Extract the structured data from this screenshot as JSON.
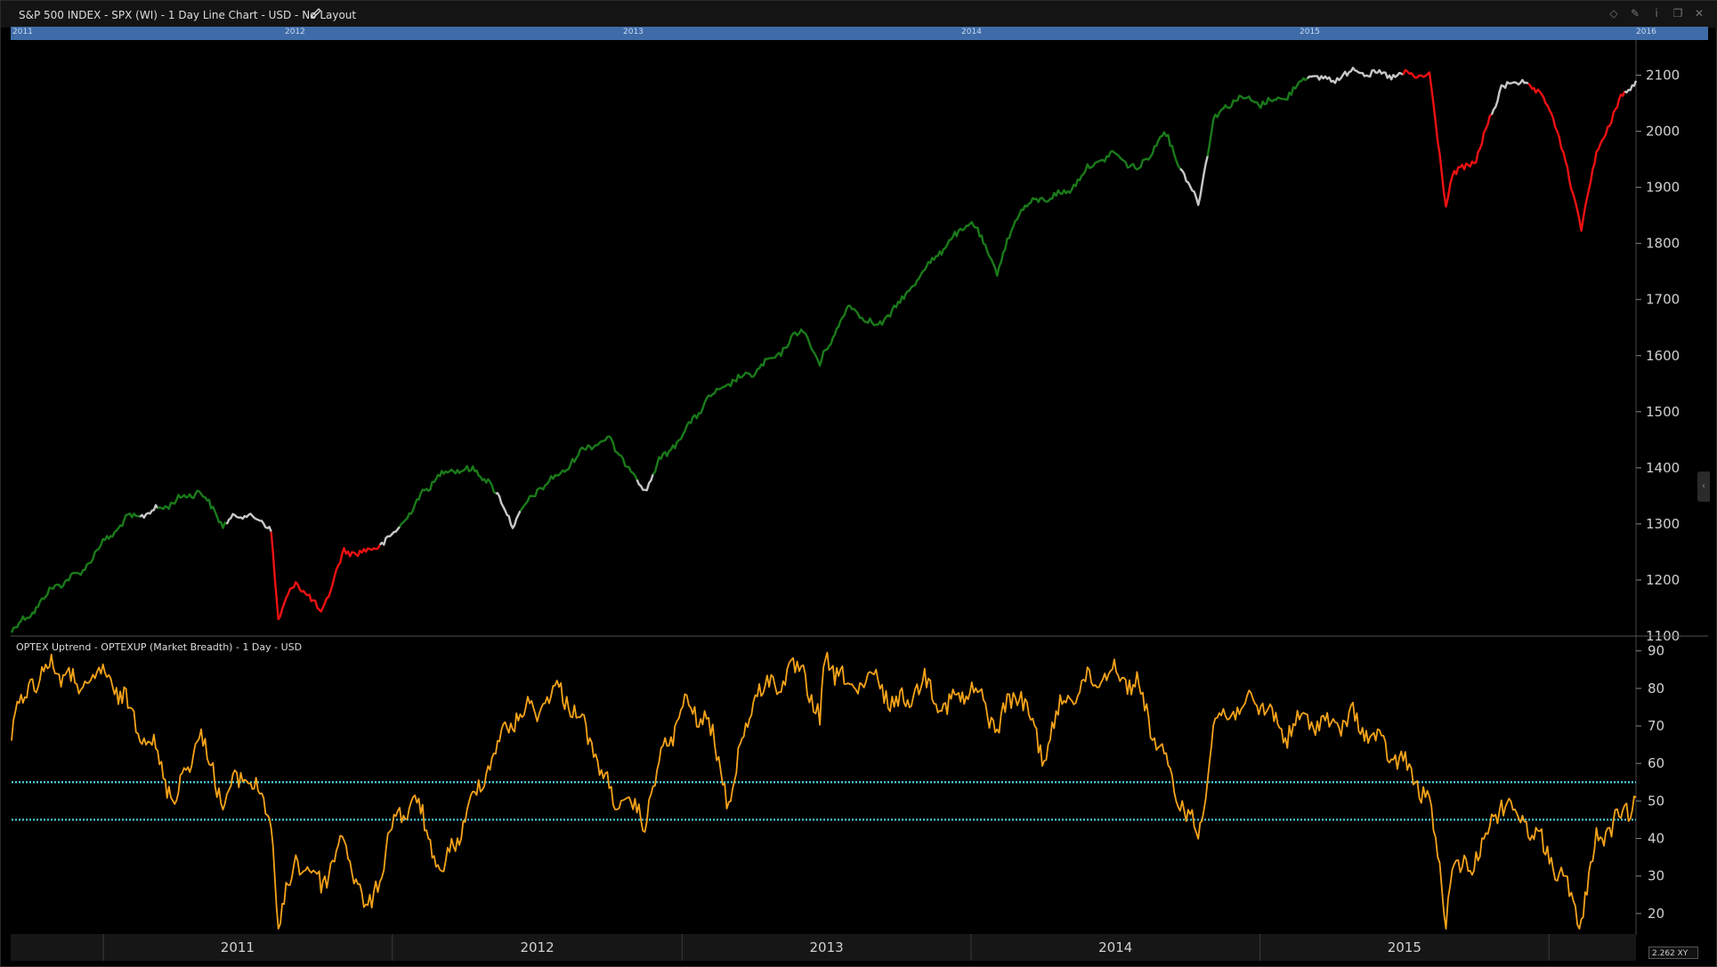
{
  "header": {
    "title": "S&P 500 INDEX - SPX (WI) - 1 Day Line Chart - USD - No Layout",
    "icons": [
      "pencil-icon",
      "diamond-icon",
      "pin-icon",
      "info-icon",
      "restore-icon",
      "close-icon"
    ]
  },
  "navigator": {
    "years": [
      "2011",
      "2012",
      "2013",
      "2014",
      "2015",
      "2016"
    ]
  },
  "lower_panel": {
    "title": "OPTEX Uptrend - OPTEXUP (Market Breadth) - 1 Day - USD"
  },
  "footer": {
    "zoom_value": "2.262",
    "zoom_suffix": "XY"
  },
  "colors": {
    "background": "#000000",
    "uptrend": "#1a7a1a",
    "neutral": "#c8c8c8",
    "downtrend": "#ee1111",
    "breadth_line": "#f5a31a",
    "threshold": "#4fd0e0",
    "navigator": "#3f6ca8"
  },
  "chart_data": [
    {
      "type": "line",
      "series": [
        {
          "name": "S&P 500 INDEX - SPX",
          "x": [
            "2010-09-07",
            "2010-10-01",
            "2010-11-01",
            "2010-12-01",
            "2011-01-03",
            "2011-02-01",
            "2011-03-01",
            "2011-04-01",
            "2011-05-02",
            "2011-06-01",
            "2011-07-01",
            "2011-08-01",
            "2011-08-10",
            "2011-09-01",
            "2011-10-03",
            "2011-11-01",
            "2011-12-01",
            "2012-01-03",
            "2012-02-01",
            "2012-03-01",
            "2012-04-02",
            "2012-05-01",
            "2012-06-01",
            "2012-07-02",
            "2012-08-01",
            "2012-09-04",
            "2012-10-01",
            "2012-11-15",
            "2012-12-03",
            "2013-01-02",
            "2013-02-01",
            "2013-03-01",
            "2013-04-01",
            "2013-05-01",
            "2013-06-03",
            "2013-06-24",
            "2013-07-01",
            "2013-08-01",
            "2013-09-03",
            "2013-10-01",
            "2013-11-01",
            "2013-12-02",
            "2014-01-02",
            "2014-02-03",
            "2014-03-03",
            "2014-04-01",
            "2014-05-01",
            "2014-06-02",
            "2014-07-01",
            "2014-08-01",
            "2014-09-02",
            "2014-10-15",
            "2014-11-03",
            "2014-12-01",
            "2015-01-02",
            "2015-02-02",
            "2015-03-02",
            "2015-04-01",
            "2015-05-01",
            "2015-06-01",
            "2015-07-01",
            "2015-08-03",
            "2015-08-24",
            "2015-09-01",
            "2015-10-01",
            "2015-11-02",
            "2015-12-01",
            "2016-01-04",
            "2016-02-11",
            "2016-03-01",
            "2016-04-01",
            "2016-04-20"
          ],
          "y": [
            1110,
            1140,
            1190,
            1210,
            1270,
            1310,
            1320,
            1340,
            1360,
            1300,
            1320,
            1290,
            1130,
            1200,
            1140,
            1250,
            1250,
            1280,
            1340,
            1390,
            1400,
            1380,
            1300,
            1360,
            1390,
            1440,
            1450,
            1360,
            1410,
            1460,
            1520,
            1550,
            1570,
            1600,
            1650,
            1580,
            1610,
            1690,
            1650,
            1690,
            1750,
            1800,
            1840,
            1750,
            1860,
            1880,
            1890,
            1940,
            1960,
            1930,
            2000,
            1870,
            2020,
            2060,
            2050,
            2060,
            2100,
            2090,
            2110,
            2100,
            2100,
            2100,
            1870,
            1920,
            1950,
            2080,
            2090,
            2040,
            1830,
            1960,
            2060,
            2090
          ]
        }
      ],
      "ylim": [
        1100,
        2150
      ],
      "grid": false,
      "axis_ticks": [
        1100,
        1200,
        1300,
        1400,
        1500,
        1600,
        1700,
        1800,
        1900,
        2000,
        2100
      ],
      "color_regimes": {
        "green": "uptrend",
        "white": "neutral",
        "red": "downtrend"
      }
    },
    {
      "type": "line",
      "series": [
        {
          "name": "OPTEX Uptrend - OPTEXUP",
          "x": [
            "2010-09-07",
            "2010-10-01",
            "2010-11-01",
            "2010-12-01",
            "2011-01-03",
            "2011-02-01",
            "2011-03-01",
            "2011-04-01",
            "2011-05-02",
            "2011-06-01",
            "2011-07-01",
            "2011-08-01",
            "2011-08-10",
            "2011-09-01",
            "2011-10-03",
            "2011-11-01",
            "2011-12-01",
            "2012-01-03",
            "2012-02-01",
            "2012-03-01",
            "2012-04-02",
            "2012-05-01",
            "2012-06-01",
            "2012-07-02",
            "2012-08-01",
            "2012-09-04",
            "2012-10-01",
            "2012-11-15",
            "2012-12-03",
            "2013-01-02",
            "2013-02-01",
            "2013-03-01",
            "2013-04-01",
            "2013-05-01",
            "2013-06-03",
            "2013-06-24",
            "2013-07-01",
            "2013-08-01",
            "2013-09-03",
            "2013-10-01",
            "2013-11-01",
            "2013-12-02",
            "2014-01-02",
            "2014-02-03",
            "2014-03-03",
            "2014-04-01",
            "2014-05-01",
            "2014-06-02",
            "2014-07-01",
            "2014-08-01",
            "2014-09-02",
            "2014-10-15",
            "2014-11-03",
            "2014-12-01",
            "2015-01-02",
            "2015-02-02",
            "2015-03-02",
            "2015-04-01",
            "2015-05-01",
            "2015-06-01",
            "2015-07-01",
            "2015-08-03",
            "2015-08-24",
            "2015-09-01",
            "2015-10-01",
            "2015-11-02",
            "2015-12-01",
            "2016-01-04",
            "2016-02-11",
            "2016-03-01",
            "2016-04-01",
            "2016-04-20"
          ],
          "y": [
            69,
            82,
            86,
            80,
            84,
            75,
            66,
            50,
            68,
            50,
            58,
            45,
            15,
            35,
            28,
            40,
            19,
            45,
            50,
            30,
            45,
            60,
            72,
            75,
            80,
            68,
            52,
            45,
            60,
            75,
            72,
            50,
            78,
            82,
            85,
            70,
            88,
            80,
            82,
            75,
            82,
            75,
            80,
            70,
            80,
            62,
            78,
            82,
            85,
            80,
            60,
            40,
            70,
            75,
            76,
            68,
            72,
            70,
            72,
            65,
            60,
            50,
            20,
            30,
            35,
            50,
            45,
            35,
            18,
            40,
            45,
            51
          ]
        }
      ],
      "ylim": [
        15,
        93
      ],
      "axis_ticks": [
        20,
        30,
        40,
        50,
        60,
        70,
        80,
        90
      ],
      "thresholds": [
        55,
        45
      ],
      "grid": false
    }
  ]
}
